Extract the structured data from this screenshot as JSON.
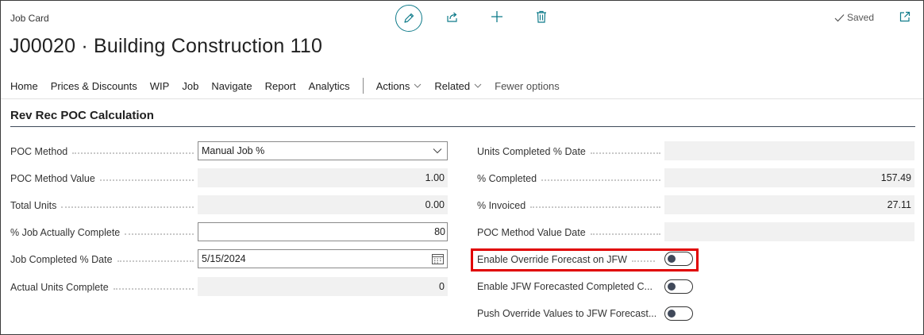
{
  "header": {
    "caption": "Job Card",
    "title": "J00020 · Building Construction 110",
    "saved_label": "Saved"
  },
  "actionbar": {
    "items": [
      "Home",
      "Prices & Discounts",
      "WIP",
      "Job",
      "Navigate",
      "Report",
      "Analytics"
    ],
    "actions_label": "Actions",
    "related_label": "Related",
    "fewer_label": "Fewer options"
  },
  "section": {
    "title": "Rev Rec POC Calculation"
  },
  "left_fields": [
    {
      "label": "POC Method",
      "value": "Manual Job %",
      "kind": "select"
    },
    {
      "label": "POC Method Value",
      "value": "1.00",
      "kind": "readonly"
    },
    {
      "label": "Total Units",
      "value": "0.00",
      "kind": "readonly"
    },
    {
      "label": "% Job Actually Complete",
      "value": "80",
      "kind": "input"
    },
    {
      "label": "Job Completed % Date",
      "value": "5/15/2024",
      "kind": "date"
    },
    {
      "label": "Actual Units Complete",
      "value": "0",
      "kind": "readonly"
    }
  ],
  "right_fields": [
    {
      "label": "Units Completed % Date",
      "value": "",
      "kind": "readonly"
    },
    {
      "label": "% Completed",
      "value": "157.49",
      "kind": "readonly"
    },
    {
      "label": "% Invoiced",
      "value": "27.11",
      "kind": "readonly"
    },
    {
      "label": "POC Method Value Date",
      "value": "",
      "kind": "readonly"
    },
    {
      "label": "Enable Override Forecast on JFW",
      "value": false,
      "kind": "toggle"
    },
    {
      "label": "Enable JFW Forecasted Completed C...",
      "value": false,
      "kind": "toggle"
    },
    {
      "label": "Push Override Values to JFW Forecast...",
      "value": false,
      "kind": "toggle"
    }
  ],
  "colors": {
    "accent": "#0f7b8a",
    "highlight": "#e00000",
    "readonly_bg": "#f1f1f1"
  }
}
